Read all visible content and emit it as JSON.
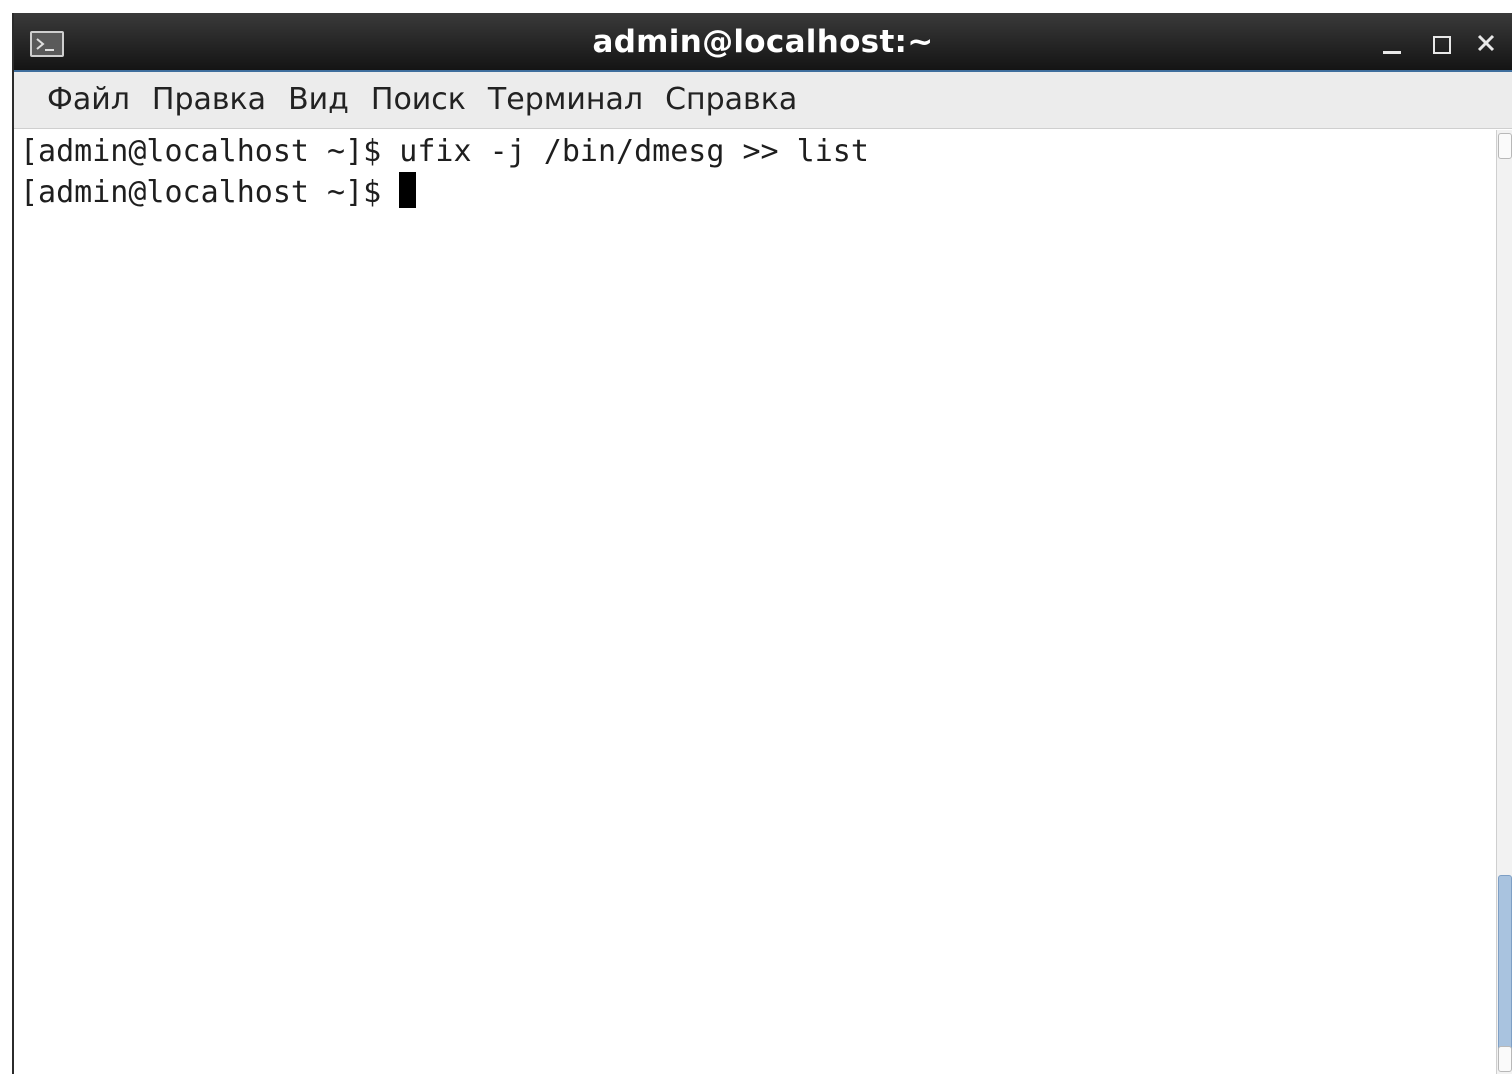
{
  "window": {
    "title": "admin@localhost:~",
    "icon": "terminal-icon",
    "controls": [
      "minimize-icon",
      "maximize-icon",
      "close-icon"
    ]
  },
  "menu": {
    "items": [
      "Файл",
      "Правка",
      "Вид",
      "Поиск",
      "Терминал",
      "Справка"
    ]
  },
  "terminal": {
    "lines": [
      "[admin@localhost ~]$ ufix -j /bin/dmesg >> list",
      "[admin@localhost ~]$ "
    ]
  },
  "colors": {
    "titlebar": "#1f1f1f",
    "titlebar_accent": "#3f6e9d",
    "menubar": "#ececec",
    "terminal_bg": "#ffffff",
    "terminal_fg": "#1e1e1e",
    "scroll_thumb": "#a9c3df"
  }
}
